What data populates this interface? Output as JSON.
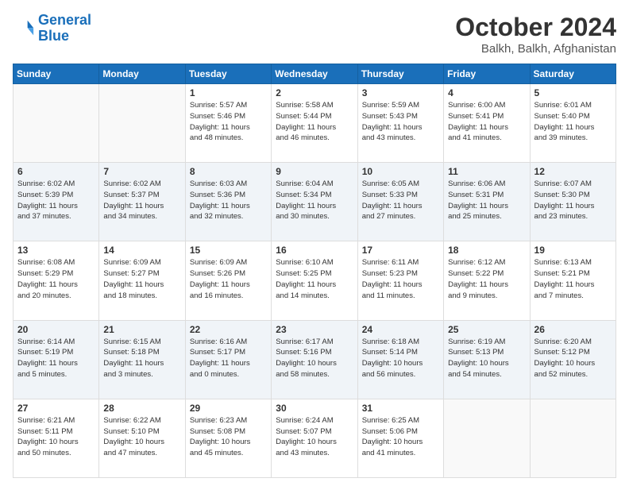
{
  "header": {
    "logo_general": "General",
    "logo_blue": "Blue",
    "month_title": "October 2024",
    "location": "Balkh, Balkh, Afghanistan"
  },
  "weekdays": [
    "Sunday",
    "Monday",
    "Tuesday",
    "Wednesday",
    "Thursday",
    "Friday",
    "Saturday"
  ],
  "weeks": [
    [
      {
        "day": "",
        "info": ""
      },
      {
        "day": "",
        "info": ""
      },
      {
        "day": "1",
        "info": "Sunrise: 5:57 AM\nSunset: 5:46 PM\nDaylight: 11 hours\nand 48 minutes."
      },
      {
        "day": "2",
        "info": "Sunrise: 5:58 AM\nSunset: 5:44 PM\nDaylight: 11 hours\nand 46 minutes."
      },
      {
        "day": "3",
        "info": "Sunrise: 5:59 AM\nSunset: 5:43 PM\nDaylight: 11 hours\nand 43 minutes."
      },
      {
        "day": "4",
        "info": "Sunrise: 6:00 AM\nSunset: 5:41 PM\nDaylight: 11 hours\nand 41 minutes."
      },
      {
        "day": "5",
        "info": "Sunrise: 6:01 AM\nSunset: 5:40 PM\nDaylight: 11 hours\nand 39 minutes."
      }
    ],
    [
      {
        "day": "6",
        "info": "Sunrise: 6:02 AM\nSunset: 5:39 PM\nDaylight: 11 hours\nand 37 minutes."
      },
      {
        "day": "7",
        "info": "Sunrise: 6:02 AM\nSunset: 5:37 PM\nDaylight: 11 hours\nand 34 minutes."
      },
      {
        "day": "8",
        "info": "Sunrise: 6:03 AM\nSunset: 5:36 PM\nDaylight: 11 hours\nand 32 minutes."
      },
      {
        "day": "9",
        "info": "Sunrise: 6:04 AM\nSunset: 5:34 PM\nDaylight: 11 hours\nand 30 minutes."
      },
      {
        "day": "10",
        "info": "Sunrise: 6:05 AM\nSunset: 5:33 PM\nDaylight: 11 hours\nand 27 minutes."
      },
      {
        "day": "11",
        "info": "Sunrise: 6:06 AM\nSunset: 5:31 PM\nDaylight: 11 hours\nand 25 minutes."
      },
      {
        "day": "12",
        "info": "Sunrise: 6:07 AM\nSunset: 5:30 PM\nDaylight: 11 hours\nand 23 minutes."
      }
    ],
    [
      {
        "day": "13",
        "info": "Sunrise: 6:08 AM\nSunset: 5:29 PM\nDaylight: 11 hours\nand 20 minutes."
      },
      {
        "day": "14",
        "info": "Sunrise: 6:09 AM\nSunset: 5:27 PM\nDaylight: 11 hours\nand 18 minutes."
      },
      {
        "day": "15",
        "info": "Sunrise: 6:09 AM\nSunset: 5:26 PM\nDaylight: 11 hours\nand 16 minutes."
      },
      {
        "day": "16",
        "info": "Sunrise: 6:10 AM\nSunset: 5:25 PM\nDaylight: 11 hours\nand 14 minutes."
      },
      {
        "day": "17",
        "info": "Sunrise: 6:11 AM\nSunset: 5:23 PM\nDaylight: 11 hours\nand 11 minutes."
      },
      {
        "day": "18",
        "info": "Sunrise: 6:12 AM\nSunset: 5:22 PM\nDaylight: 11 hours\nand 9 minutes."
      },
      {
        "day": "19",
        "info": "Sunrise: 6:13 AM\nSunset: 5:21 PM\nDaylight: 11 hours\nand 7 minutes."
      }
    ],
    [
      {
        "day": "20",
        "info": "Sunrise: 6:14 AM\nSunset: 5:19 PM\nDaylight: 11 hours\nand 5 minutes."
      },
      {
        "day": "21",
        "info": "Sunrise: 6:15 AM\nSunset: 5:18 PM\nDaylight: 11 hours\nand 3 minutes."
      },
      {
        "day": "22",
        "info": "Sunrise: 6:16 AM\nSunset: 5:17 PM\nDaylight: 11 hours\nand 0 minutes."
      },
      {
        "day": "23",
        "info": "Sunrise: 6:17 AM\nSunset: 5:16 PM\nDaylight: 10 hours\nand 58 minutes."
      },
      {
        "day": "24",
        "info": "Sunrise: 6:18 AM\nSunset: 5:14 PM\nDaylight: 10 hours\nand 56 minutes."
      },
      {
        "day": "25",
        "info": "Sunrise: 6:19 AM\nSunset: 5:13 PM\nDaylight: 10 hours\nand 54 minutes."
      },
      {
        "day": "26",
        "info": "Sunrise: 6:20 AM\nSunset: 5:12 PM\nDaylight: 10 hours\nand 52 minutes."
      }
    ],
    [
      {
        "day": "27",
        "info": "Sunrise: 6:21 AM\nSunset: 5:11 PM\nDaylight: 10 hours\nand 50 minutes."
      },
      {
        "day": "28",
        "info": "Sunrise: 6:22 AM\nSunset: 5:10 PM\nDaylight: 10 hours\nand 47 minutes."
      },
      {
        "day": "29",
        "info": "Sunrise: 6:23 AM\nSunset: 5:08 PM\nDaylight: 10 hours\nand 45 minutes."
      },
      {
        "day": "30",
        "info": "Sunrise: 6:24 AM\nSunset: 5:07 PM\nDaylight: 10 hours\nand 43 minutes."
      },
      {
        "day": "31",
        "info": "Sunrise: 6:25 AM\nSunset: 5:06 PM\nDaylight: 10 hours\nand 41 minutes."
      },
      {
        "day": "",
        "info": ""
      },
      {
        "day": "",
        "info": ""
      }
    ]
  ]
}
